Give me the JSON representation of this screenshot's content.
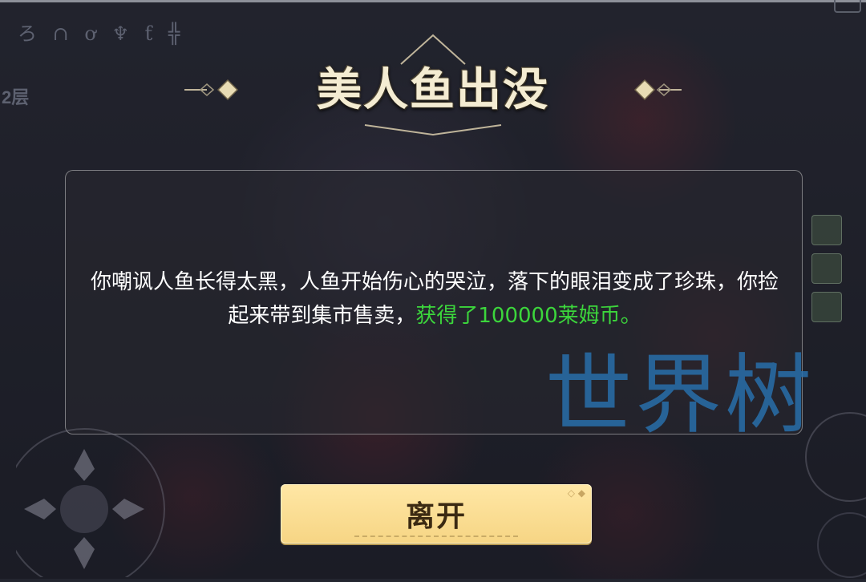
{
  "hud": {
    "runes": "ろ ∩ ơ ♆ ƭ ╬",
    "floor": "2层"
  },
  "event": {
    "title": "美人鱼出没",
    "message_main": "你嘲讽人鱼长得太黑，人鱼开始伤心的哭泣，落下的眼泪变成了珍珠，你捡起来带到集市售卖，",
    "message_reward": "获得了100000莱姆币。",
    "reward_color": "#3cd63c"
  },
  "buttons": {
    "leave_label": "离开"
  },
  "watermark": {
    "text": "世界树"
  },
  "icons": [
    "dpad-icon",
    "side-skill-icon",
    "rune-icon"
  ]
}
